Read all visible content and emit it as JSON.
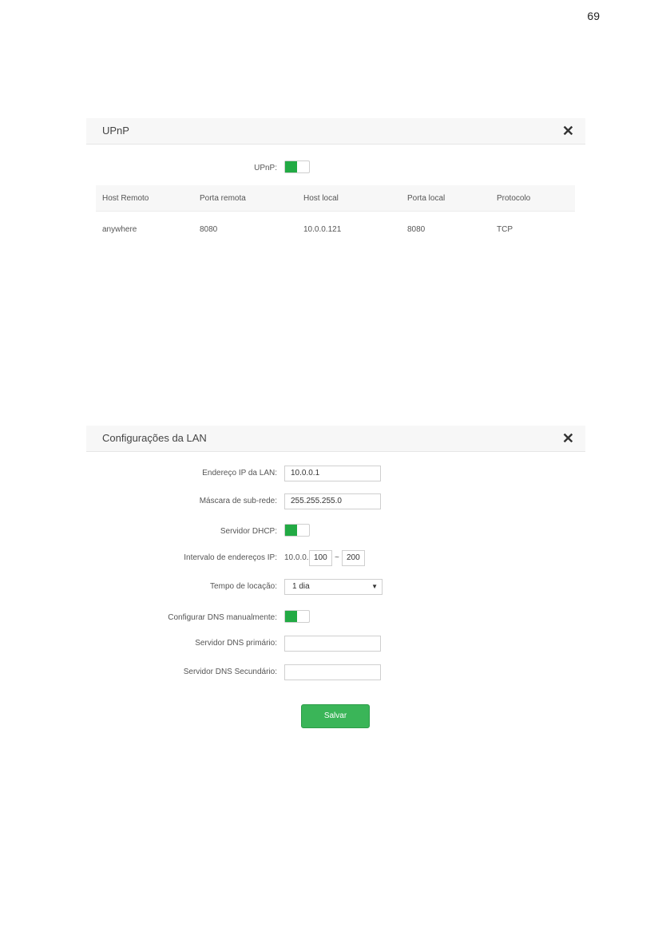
{
  "page_number": "69",
  "upnp": {
    "title": "UPnP",
    "close": "✕",
    "toggle_label": "UPnP:",
    "toggle_on": true,
    "columns": [
      "Host Remoto",
      "Porta remota",
      "Host local",
      "Porta local",
      "Protocolo"
    ],
    "rows": [
      [
        "anywhere",
        "8080",
        "10.0.0.121",
        "8080",
        "TCP"
      ]
    ]
  },
  "lan": {
    "title": "Configurações da LAN",
    "close": "✕",
    "ip_label": "Endereço IP da LAN:",
    "ip_value": "10.0.0.1",
    "mask_label": "Máscara de sub-rede:",
    "mask_value": "255.255.255.0",
    "dhcp_label": "Servidor DHCP:",
    "dhcp_on": true,
    "range_label": "Intervalo de endereços IP:",
    "range_prefix": "10.0.0.",
    "range_start": "100",
    "range_sep": "~",
    "range_end": "200",
    "lease_label": "Tempo de locação:",
    "lease_value": "1 dia",
    "lease_caret": "▼",
    "dns_manual_label": "Configurar DNS manualmente:",
    "dns_manual_on": true,
    "dns_primary_label": "Servidor DNS primário:",
    "dns_primary_value": "",
    "dns_secondary_label": "Servidor DNS Secundário:",
    "dns_secondary_value": "",
    "save_label": "Salvar"
  },
  "colors": {
    "accent": "#22aa44",
    "button": "#3ab558"
  }
}
